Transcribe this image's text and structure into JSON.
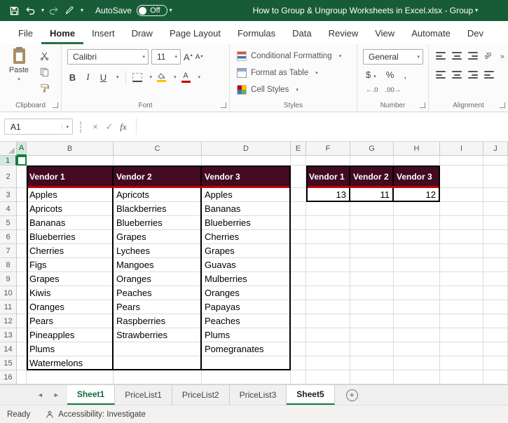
{
  "titlebar": {
    "autosave_label": "AutoSave",
    "autosave_state": "Off",
    "title": "How to Group & Ungroup Worksheets in Excel.xlsx  -  Group"
  },
  "ribbon_tabs": [
    {
      "label": "File",
      "active": false
    },
    {
      "label": "Home",
      "active": true
    },
    {
      "label": "Insert",
      "active": false
    },
    {
      "label": "Draw",
      "active": false
    },
    {
      "label": "Page Layout",
      "active": false
    },
    {
      "label": "Formulas",
      "active": false
    },
    {
      "label": "Data",
      "active": false
    },
    {
      "label": "Review",
      "active": false
    },
    {
      "label": "View",
      "active": false
    },
    {
      "label": "Automate",
      "active": false
    },
    {
      "label": "Dev",
      "active": false
    }
  ],
  "ribbon": {
    "clipboard": {
      "group_label": "Clipboard",
      "paste_label": "Paste"
    },
    "font": {
      "group_label": "Font",
      "family": "Calibri",
      "size": "11",
      "bold": "B",
      "italic": "I",
      "underline": "U",
      "grow": "A",
      "shrink": "A"
    },
    "styles": {
      "group_label": "Styles",
      "conditional_formatting": "Conditional Formatting",
      "format_as_table": "Format as Table",
      "cell_styles": "Cell Styles"
    },
    "number": {
      "group_label": "Number",
      "format": "General",
      "currency": "$",
      "percent": "%",
      "comma": ",",
      "increase_decimal": "←.0",
      "decrease_decimal": ".00→"
    },
    "alignment": {
      "group_label": "Alignment",
      "orientation": "ab"
    }
  },
  "formula_bar": {
    "name_box": "A1",
    "fx_label": "fx"
  },
  "grid": {
    "selected_cell": "A1",
    "col_headers": [
      "A",
      "B",
      "C",
      "D",
      "E",
      "F",
      "G",
      "H",
      "I",
      "J"
    ],
    "row_headers": [
      "1",
      "2",
      "3",
      "4",
      "5",
      "6",
      "7",
      "8",
      "9",
      "10",
      "11",
      "12",
      "13",
      "14",
      "15",
      "16"
    ],
    "table1": {
      "headers": [
        "Vendor 1",
        "Vendor 2",
        "Vendor 3"
      ],
      "rows": [
        [
          "Apples",
          "Apricots",
          "Apples"
        ],
        [
          "Apricots",
          "Blackberries",
          "Bananas"
        ],
        [
          "Bananas",
          "Blueberries",
          "Blueberries"
        ],
        [
          "Blueberries",
          "Grapes",
          "Cherries"
        ],
        [
          "Cherries",
          "Lychees",
          "Grapes"
        ],
        [
          "Figs",
          "Mangoes",
          "Guavas"
        ],
        [
          "Grapes",
          "Oranges",
          "Mulberries"
        ],
        [
          "Kiwis",
          "Peaches",
          "Oranges"
        ],
        [
          "Oranges",
          "Pears",
          "Papayas"
        ],
        [
          "Pears",
          "Raspberries",
          "Peaches"
        ],
        [
          "Pineapples",
          "Strawberries",
          "Plums"
        ],
        [
          "Plums",
          "",
          "Pomegranates"
        ],
        [
          "Watermelons",
          "",
          ""
        ]
      ]
    },
    "table2": {
      "headers": [
        "Vendor 1",
        "Vendor 2",
        "Vendor 3"
      ],
      "values": [
        "13",
        "11",
        "12"
      ]
    }
  },
  "sheet_tabs": [
    {
      "label": "Sheet1",
      "state": "active"
    },
    {
      "label": "PriceList1",
      "state": "normal"
    },
    {
      "label": "PriceList2",
      "state": "normal"
    },
    {
      "label": "PriceList3",
      "state": "normal"
    },
    {
      "label": "Sheet5",
      "state": "grouped"
    }
  ],
  "status_bar": {
    "mode": "Ready",
    "accessibility": "Accessibility: Investigate"
  },
  "colors": {
    "titlebar_green": "#185C37",
    "accent_green": "#107C41",
    "vendor_header_fill": "#430A21",
    "vendor_header_accent": "#C00000"
  }
}
